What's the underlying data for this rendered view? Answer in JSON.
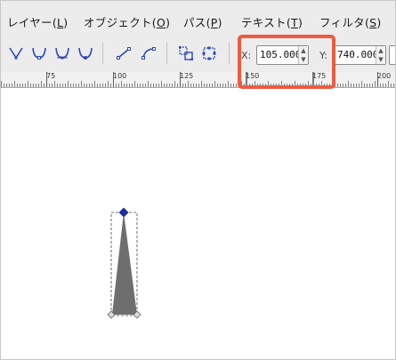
{
  "menubar": {
    "items": [
      {
        "label": "レイヤー(",
        "accel": "L",
        "tail": ")"
      },
      {
        "label": "オブジェクト(",
        "accel": "O",
        "tail": ")"
      },
      {
        "label": "パス(",
        "accel": "P",
        "tail": ")"
      },
      {
        "label": "テキスト(",
        "accel": "T",
        "tail": ")"
      },
      {
        "label": "フィルタ(",
        "accel": "S",
        "tail": ")"
      }
    ]
  },
  "toolbar": {
    "icons": [
      "node-cusp-icon",
      "node-smooth-icon",
      "node-symmetric-icon",
      "node-auto-smooth-icon",
      "segment-to-line-icon",
      "segment-to-curve-icon",
      "object-to-path-icon",
      "stroke-to-path-icon"
    ],
    "x_label": "X:",
    "x_value": "105.000",
    "y_label": "Y:",
    "y_value": "740.000"
  },
  "ruler": {
    "labels": [
      "75",
      "100",
      "125",
      "150",
      "175",
      "200"
    ]
  },
  "colors": {
    "highlight": "#f05a40",
    "shape_fill": "#6e6e6e",
    "selected_node": "#1a2fa8"
  }
}
